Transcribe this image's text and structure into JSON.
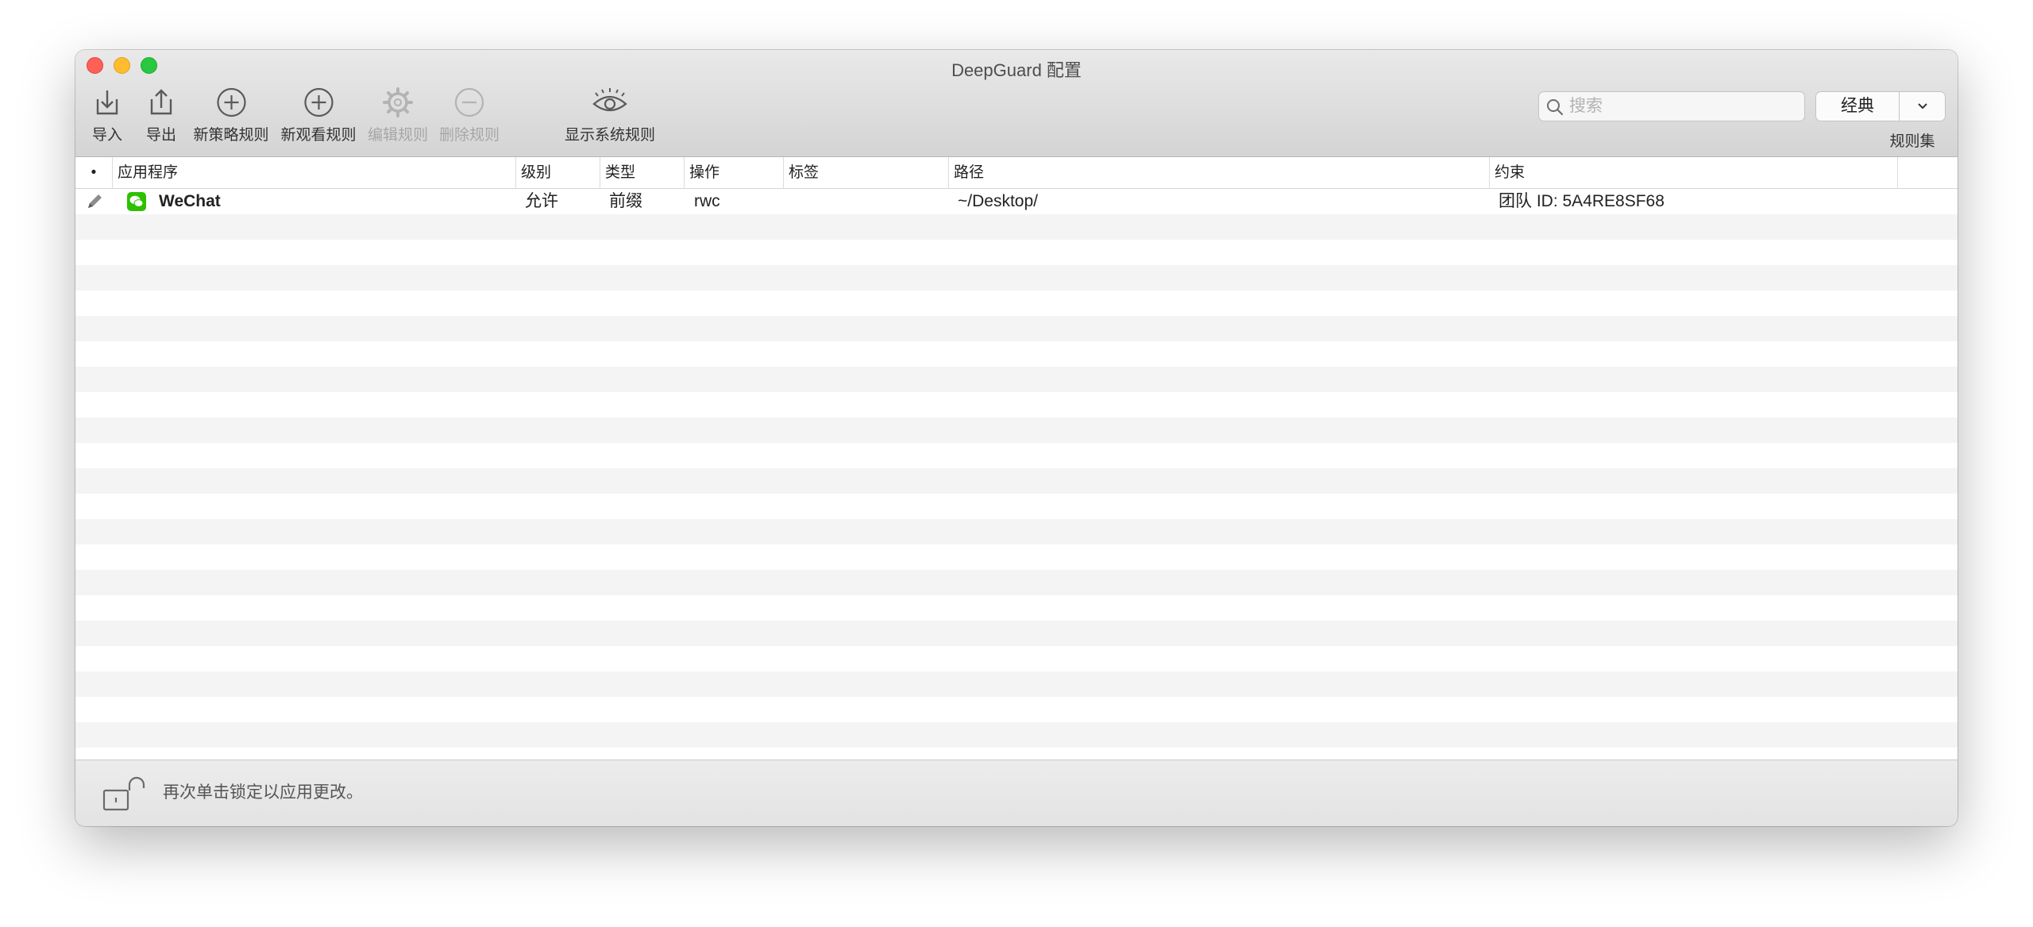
{
  "window": {
    "title": "DeepGuard 配置"
  },
  "toolbar": {
    "import_label": "导入",
    "export_label": "导出",
    "new_policy_rule_label": "新策略规则",
    "new_watch_rule_label": "新观看规则",
    "edit_rule_label": "编辑规则",
    "delete_rule_label": "删除规则",
    "show_system_rules_label": "显示系统规则",
    "search_placeholder": "搜索",
    "ruleset_value": "经典",
    "ruleset_label": "规则集"
  },
  "table": {
    "columns": {
      "status": "•",
      "app": "应用程序",
      "level": "级别",
      "type": "类型",
      "operation": "操作",
      "tag": "标签",
      "path": "路径",
      "constraint": "约束"
    },
    "rows": [
      {
        "app": "WeChat",
        "level": "允许",
        "type": "前缀",
        "operation": "rwc",
        "tag": "",
        "path": "~/Desktop/",
        "constraint": "团队 ID: 5A4RE8SF68"
      }
    ]
  },
  "footer": {
    "lock_text": "再次单击锁定以应用更改。"
  },
  "colors": {
    "close": "#fe5f57",
    "minimize": "#febc2e",
    "maximize": "#28c840",
    "wechat_green": "#2dc100"
  },
  "icons": {
    "import": "import-icon",
    "export": "export-icon",
    "new_policy": "plus-circle-icon",
    "new_watch": "plus-circle-icon",
    "edit": "gear-icon",
    "delete": "minus-circle-icon",
    "show_system": "eye-icon",
    "search": "search-icon",
    "lock": "unlocked-padlock-icon"
  }
}
